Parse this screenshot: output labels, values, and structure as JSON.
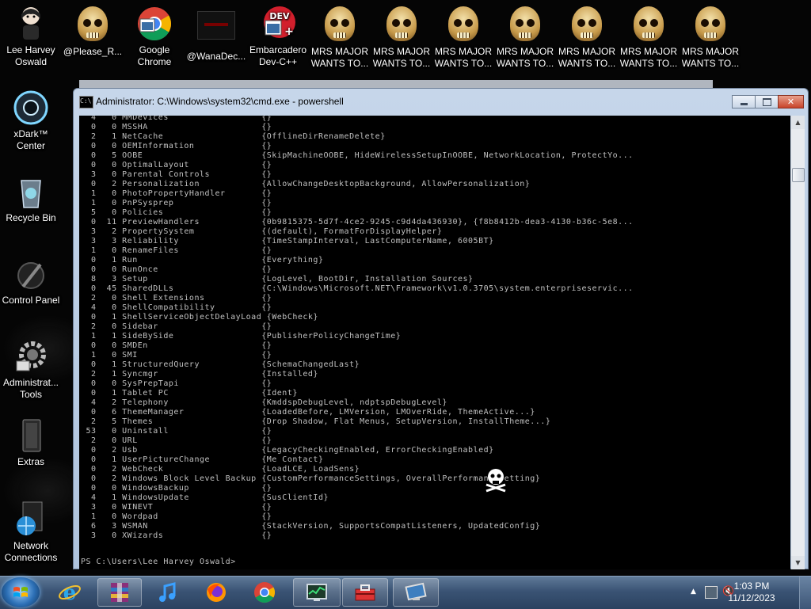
{
  "desktop": {
    "icons_top": [
      {
        "label1": "Lee Harvey",
        "label2": "Oswald"
      },
      {
        "label1": "@Please_R...",
        "label2": ""
      },
      {
        "label1": "Google",
        "label2": "Chrome"
      },
      {
        "label1": "@WanaDec...",
        "label2": ""
      },
      {
        "label1": "Embarcadero",
        "label2": "Dev-C++"
      },
      {
        "label1": "MRS MAJOR",
        "label2": "WANTS TO..."
      },
      {
        "label1": "MRS MAJOR",
        "label2": "WANTS TO..."
      },
      {
        "label1": "MRS MAJOR",
        "label2": "WANTS TO..."
      },
      {
        "label1": "MRS MAJOR",
        "label2": "WANTS TO..."
      },
      {
        "label1": "MRS MAJOR",
        "label2": "WANTS TO..."
      },
      {
        "label1": "MRS MAJOR",
        "label2": "WANTS TO..."
      },
      {
        "label1": "MRS MAJOR",
        "label2": "WANTS TO..."
      }
    ],
    "icons_left": [
      {
        "label1": "xDark™",
        "label2": "Center"
      },
      {
        "label1": "Recycle Bin",
        "label2": ""
      },
      {
        "label1": "Control Panel",
        "label2": ""
      },
      {
        "label1": "Administrat...",
        "label2": "Tools"
      },
      {
        "label1": "Extras",
        "label2": ""
      },
      {
        "label1": "Network",
        "label2": "Connections"
      }
    ]
  },
  "window": {
    "title": "Administrator: C:\\Windows\\system32\\cmd.exe - powershell",
    "icon": "cmd-icon",
    "console_lines": [
      "  4   0 MMDevices                  {}",
      "  0   0 MSSHA                      {}",
      "  2   1 NetCache                   {OfflineDirRenameDelete}",
      "  0   0 OEMInformation             {}",
      "  0   5 OOBE                       {SkipMachineOOBE, HideWirelessSetupInOOBE, NetworkLocation, ProtectYo...",
      "  0   0 OptimalLayout              {}",
      "  3   0 Parental Controls          {}",
      "  0   2 Personalization            {AllowChangeDesktopBackground, AllowPersonalization}",
      "  1   0 PhotoPropertyHandler       {}",
      "  1   0 PnPSysprep                 {}",
      "  5   0 Policies                   {}",
      "  0  11 PreviewHandlers            {0b9815375-5d7f-4ce2-9245-c9d4da436930}, {f8b8412b-dea3-4130-b36c-5e8...",
      "  3   2 PropertySystem             {(default), FormatForDisplayHelper}",
      "  3   3 Reliability                {TimeStampInterval, LastComputerName, 6005BT}",
      "  1   0 RenameFiles                {}",
      "  0   1 Run                        {Everything}",
      "  0   0 RunOnce                    {}",
      "  8   3 Setup                      {LogLevel, BootDir, Installation Sources}",
      "  0  45 SharedDLLs                 {C:\\Windows\\Microsoft.NET\\Framework\\v1.0.3705\\system.enterpriseservic...",
      "  2   0 Shell Extensions           {}",
      "  4   0 ShellCompatibility         {}",
      "  0   1 ShellServiceObjectDelayLoad {WebCheck}",
      "  2   0 Sidebar                    {}",
      "  1   1 SideBySide                 {PublisherPolicyChangeTime}",
      "  0   0 SMDEn                      {}",
      "  1   0 SMI                        {}",
      "  0   1 StructuredQuery            {SchemaChangedLast}",
      "  2   1 Syncmgr                    {Installed}",
      "  0   0 SysPrepTapi                {}",
      "  0   1 Tablet PC                  {Ident}",
      "  4   2 Telephony                  {KmddspDebugLevel, ndptspDebugLevel}",
      "  0   6 ThemeManager               {LoadedBefore, LMVersion, LMOverRide, ThemeActive...}",
      "  2   5 Themes                     {Drop Shadow, Flat Menus, SetupVersion, InstallTheme...}",
      " 53   0 Uninstall                  {}",
      "  2   0 URL                        {}",
      "  0   2 Usb                        {LegacyCheckingEnabled, ErrorCheckingEnabled}",
      "  0   1 UserPictureChange          {Me Contact}",
      "  0   2 WebCheck                   {LoadLCE, LoadSens}",
      "  0   2 Windows Block Level Backup {CustomPerformanceSettings, OverallPerformanceSetting}",
      "  0   0 WindowsBackup              {}",
      "  4   1 WindowsUpdate              {SusClientId}",
      "  3   0 WINEVT                     {}",
      "  1   0 Wordpad                    {}",
      "  6   3 WSMAN                      {StackVersion, SupportsCompatListeners, UpdatedConfig}",
      "  3   0 XWizards                   {}"
    ],
    "prompt": "PS C:\\Users\\Lee Harvey Oswald>"
  },
  "taskbar": {
    "pinned": [
      "internet-explorer-icon",
      "winrar-icon",
      "itunes-icon",
      "firefox-icon",
      "chrome-icon",
      "task-manager-icon",
      "toolbox-icon",
      "screen-icon"
    ],
    "clock_time": "1:03 PM",
    "clock_date": "11/12/2023"
  },
  "colors": {
    "console_text": "#c0c0c0",
    "console_bg": "#000000",
    "taskbar": "#3a5374"
  }
}
